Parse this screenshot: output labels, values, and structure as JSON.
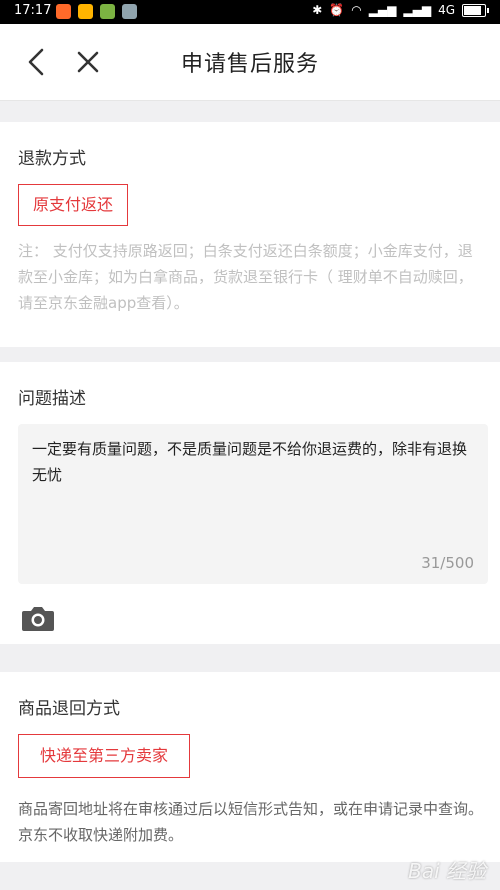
{
  "status_bar": {
    "time": "17:17",
    "network": "4G"
  },
  "nav": {
    "title": "申请售后服务"
  },
  "refund": {
    "title": "退款方式",
    "option": "原支付返还",
    "note": "注：  支付仅支持原路返回；白条支付返还白条额度；小金库支付，退款至小金库；如为白拿商品，货款退至银行卡（ 理财单不自动赎回，请至京东金融app查看）。"
  },
  "problem": {
    "title": "问题描述",
    "value": "一定要有质量问题，不是质量问题是不给你退运费的，除非有退换无忧",
    "counter": "31/500"
  },
  "return_method": {
    "title": "商品退回方式",
    "option": "快递至第三方卖家",
    "note": "商品寄回地址将在审核通过后以短信形式告知，或在申请记录中查询。京东不收取快递附加费。"
  },
  "watermark": "Bai 经验",
  "colors": {
    "accent": "#e4393c",
    "note_gray": "#c0c0c0",
    "note_dark": "#666666"
  }
}
